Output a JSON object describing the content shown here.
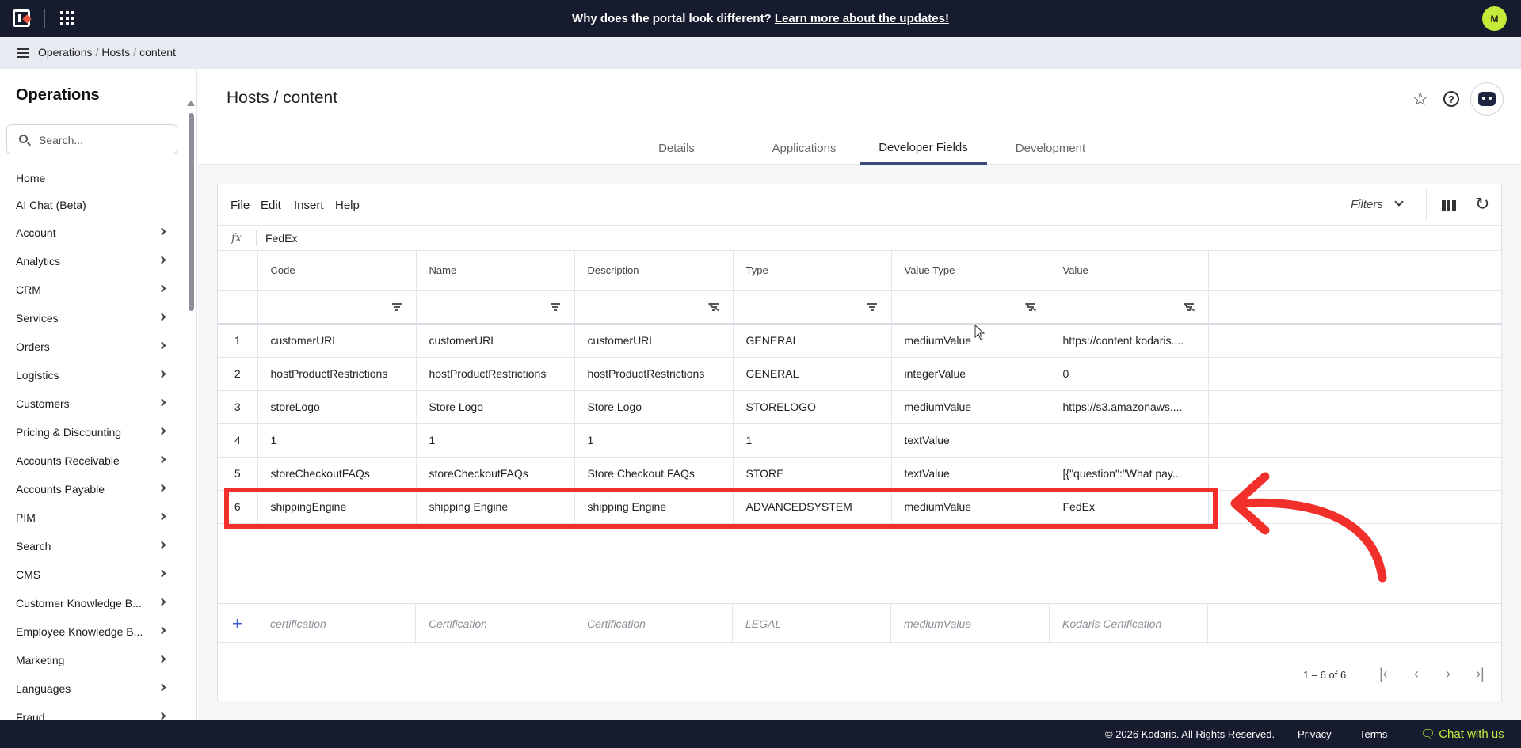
{
  "topbar": {
    "announcement_text": "Why does the portal look different?",
    "announcement_link": "Learn more about the updates!",
    "avatar_initial": "M"
  },
  "breadcrumb": [
    "Operations",
    "Hosts",
    "content"
  ],
  "sidebar": {
    "title": "Operations",
    "search_placeholder": "Search...",
    "items": [
      {
        "label": "Home",
        "chevron": false
      },
      {
        "label": "AI Chat (Beta)",
        "chevron": false
      },
      {
        "label": "Account",
        "chevron": true
      },
      {
        "label": "Analytics",
        "chevron": true
      },
      {
        "label": "CRM",
        "chevron": true
      },
      {
        "label": "Services",
        "chevron": true
      },
      {
        "label": "Orders",
        "chevron": true
      },
      {
        "label": "Logistics",
        "chevron": true
      },
      {
        "label": "Customers",
        "chevron": true
      },
      {
        "label": "Pricing & Discounting",
        "chevron": true
      },
      {
        "label": "Accounts Receivable",
        "chevron": true
      },
      {
        "label": "Accounts Payable",
        "chevron": true
      },
      {
        "label": "PIM",
        "chevron": true
      },
      {
        "label": "Search",
        "chevron": true
      },
      {
        "label": "CMS",
        "chevron": true
      },
      {
        "label": "Customer Knowledge B...",
        "chevron": true
      },
      {
        "label": "Employee Knowledge B...",
        "chevron": true
      },
      {
        "label": "Marketing",
        "chevron": true
      },
      {
        "label": "Languages",
        "chevron": true
      },
      {
        "label": "Fraud",
        "chevron": true
      }
    ]
  },
  "page": {
    "title": "Hosts / content",
    "tabs": [
      "Details",
      "Applications",
      "Developer Fields",
      "Development"
    ],
    "active_tab": "Developer Fields"
  },
  "grid": {
    "menu": [
      "File",
      "Edit",
      "Insert",
      "Help"
    ],
    "filters_label": "Filters",
    "formula_label": "fx",
    "formula_value": "FedEx",
    "columns": [
      "Code",
      "Name",
      "Description",
      "Type",
      "Value Type",
      "Value"
    ],
    "rows": [
      {
        "num": "1",
        "cells": [
          "customerURL",
          "customerURL",
          "customerURL",
          "GENERAL",
          "mediumValue",
          "https://content.kodaris...."
        ]
      },
      {
        "num": "2",
        "cells": [
          "hostProductRestrictions",
          "hostProductRestrictions",
          "hostProductRestrictions",
          "GENERAL",
          "integerValue",
          "0"
        ]
      },
      {
        "num": "3",
        "cells": [
          "storeLogo",
          "Store Logo",
          "Store Logo",
          "STORELOGO",
          "mediumValue",
          "https://s3.amazonaws...."
        ]
      },
      {
        "num": "4",
        "cells": [
          "1",
          "1",
          "1",
          "1",
          "textValue",
          ""
        ]
      },
      {
        "num": "5",
        "cells": [
          "storeCheckoutFAQs",
          "storeCheckoutFAQs",
          "Store Checkout FAQs",
          "STORE",
          "textValue",
          "[{\"question\":\"What pay..."
        ]
      },
      {
        "num": "6",
        "cells": [
          "shippingEngine",
          "shipping Engine",
          "shipping Engine",
          "ADVANCEDSYSTEM",
          "mediumValue",
          "FedEx"
        ]
      }
    ],
    "new_row_placeholders": [
      "certification",
      "Certification",
      "Certification",
      "LEGAL",
      "mediumValue",
      "Kodaris Certification"
    ],
    "pager_text": "1 – 6 of 6"
  },
  "footer": {
    "copyright": "© 2026 Kodaris. All Rights Reserved.",
    "privacy": "Privacy",
    "terms": "Terms",
    "chat": "Chat with us"
  },
  "colors": {
    "topbar_bg": "#161b2e",
    "accent_lime": "#c6ea3a",
    "annotation_red": "#f2302b"
  }
}
